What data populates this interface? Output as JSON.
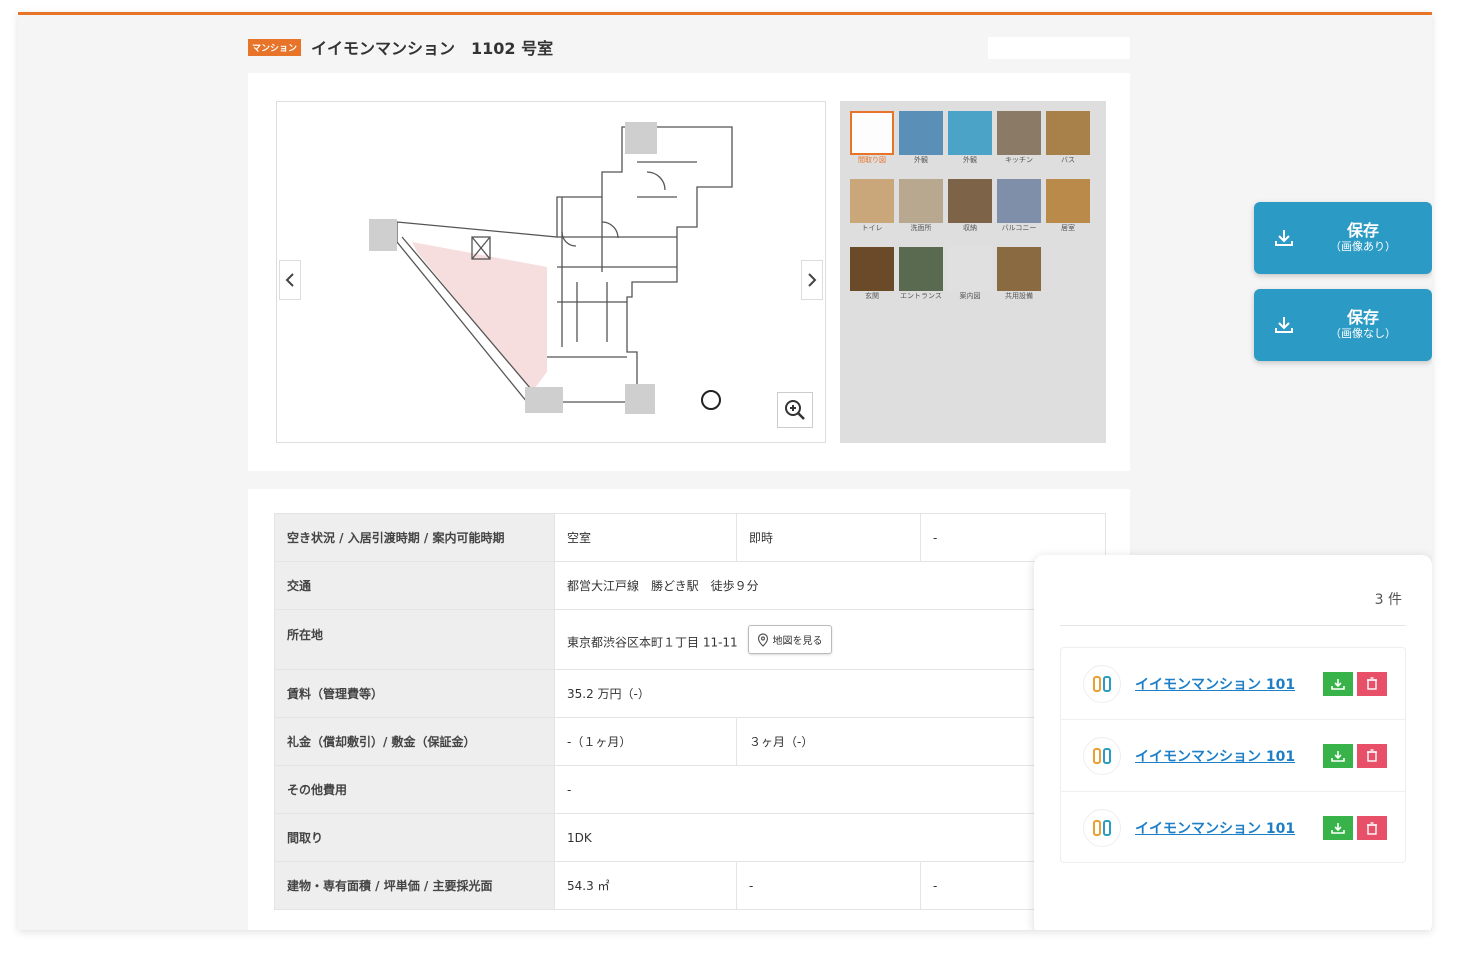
{
  "header": {
    "type_badge": "マンション",
    "title": "イイモンマンション　1102 号室"
  },
  "viewer": {
    "prev_icon": "chevron-left-icon",
    "next_icon": "chevron-right-icon",
    "zoom_icon": "zoom-in-icon",
    "thumbnails": [
      {
        "label": "間取り図",
        "active": true,
        "color": "#ffffff"
      },
      {
        "label": "外観",
        "active": false,
        "color": "#5a8fb8"
      },
      {
        "label": "外観",
        "active": false,
        "color": "#4ba3c8"
      },
      {
        "label": "キッチン",
        "active": false,
        "color": "#8a7a66"
      },
      {
        "label": "バス",
        "active": false,
        "color": "#a8804a"
      },
      {
        "label": "トイレ",
        "active": false,
        "color": "#c9a77a"
      },
      {
        "label": "洗面所",
        "active": false,
        "color": "#b9a890"
      },
      {
        "label": "収納",
        "active": false,
        "color": "#7d6448"
      },
      {
        "label": "バルコニー",
        "active": false,
        "color": "#7f8faa"
      },
      {
        "label": "居室",
        "active": false,
        "color": "#b98a4a"
      },
      {
        "label": "玄関",
        "active": false,
        "color": "#6b4a2a"
      },
      {
        "label": "エントランス",
        "active": false,
        "color": "#5a6a50"
      },
      {
        "label": "案内図",
        "active": false,
        "color": "#e0e0e0"
      },
      {
        "label": "共用設備",
        "active": false,
        "color": "#8a6a40"
      }
    ]
  },
  "save_buttons": [
    {
      "label": "保存",
      "sub": "（画像あり）",
      "icon": "download-icon"
    },
    {
      "label": "保存",
      "sub": "（画像なし）",
      "icon": "download-icon"
    }
  ],
  "info": {
    "rows": [
      {
        "head": "空き状況 / 入居引渡時期 / 案内可能時期",
        "cells": [
          "空室",
          "即時",
          "-"
        ]
      },
      {
        "head": "交通",
        "cells": [
          "都営大江戸線　勝どき駅　徒歩９分"
        ]
      },
      {
        "head": "所在地",
        "cells": [
          "東京都渋谷区本町１丁目 11-11"
        ],
        "map_button": "地図を見る"
      },
      {
        "head": "賃料（管理費等）",
        "cells": [
          "35.2 万円（-）"
        ]
      },
      {
        "head": "礼金（償却敷引）/ 敷金（保証金）",
        "cells": [
          "-（１ヶ月）",
          "３ヶ月（-）"
        ]
      },
      {
        "head": "その他費用",
        "cells": [
          "-"
        ]
      },
      {
        "head": "間取り",
        "cells": [
          "1DK"
        ]
      },
      {
        "head": "建物・専有面積 / 坪単価 / 主要採光面",
        "cells": [
          "54.3 ㎡",
          "-",
          "-"
        ]
      }
    ]
  },
  "list_panel": {
    "count": "3 件",
    "items": [
      {
        "name": "イイモンマンション 101"
      },
      {
        "name": "イイモンマンション 101"
      },
      {
        "name": "イイモンマンション 101"
      }
    ]
  }
}
